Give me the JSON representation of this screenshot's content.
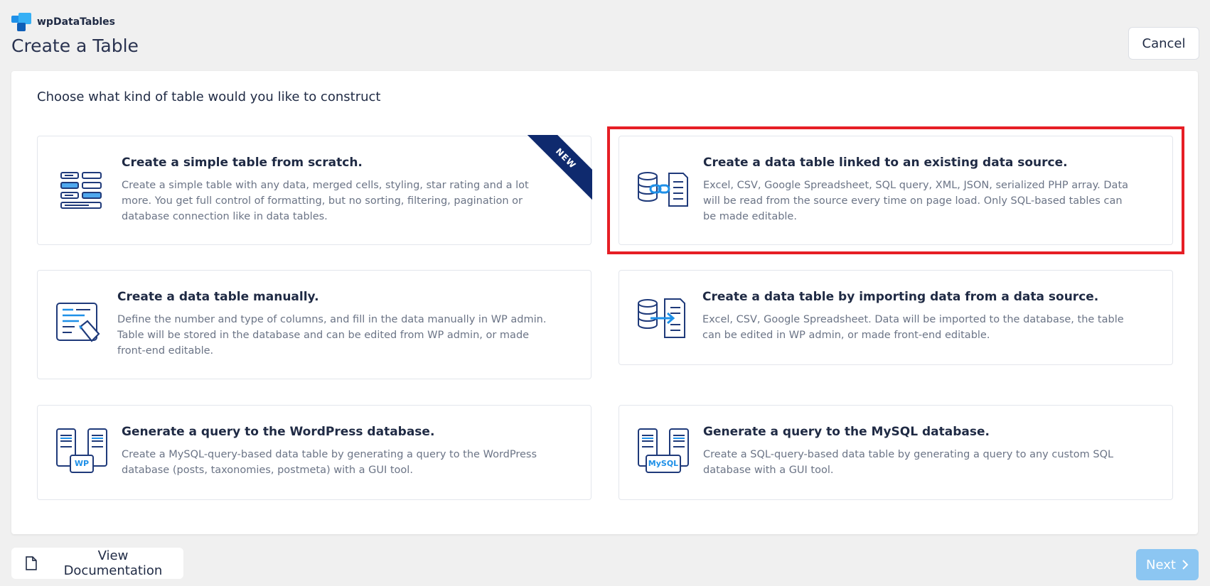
{
  "app": {
    "name": "wpDataTables"
  },
  "page": {
    "title": "Create a Table"
  },
  "header": {
    "cancel_label": "Cancel"
  },
  "main": {
    "heading": "Choose what kind of table would you like to construct",
    "badge_new": "NEW",
    "cards": [
      {
        "title": "Create a simple table from scratch.",
        "description": "Create a simple table with any data, merged cells, styling, star rating and a lot more. You get full control of formatting, but no sorting, filtering, pagination or database connection like in data tables.",
        "icon": "simple-table-icon"
      },
      {
        "title": "Create a data table linked to an existing data source.",
        "description": "Excel, CSV, Google Spreadsheet, SQL query, XML, JSON, serialized PHP array. Data will be read from the source every time on page load. Only SQL-based tables can be made editable.",
        "icon": "linked-data-source-icon"
      },
      {
        "title": "Create a data table manually.",
        "description": "Define the number and type of columns, and fill in the data manually in WP admin. Table will be stored in the database and can be edited from WP admin, or made front-end editable.",
        "icon": "manual-table-icon"
      },
      {
        "title": "Create a data table by importing data from a data source.",
        "description": "Excel, CSV, Google Spreadsheet. Data will be imported to the database, the table can be edited in WP admin, or made front-end editable.",
        "icon": "import-data-icon"
      },
      {
        "title": "Generate a query to the WordPress database.",
        "description": "Create a MySQL-query-based data table by generating a query to the WordPress database (posts, taxonomies, postmeta) with a GUI tool.",
        "icon": "wp-query-icon",
        "icon_label": "WP"
      },
      {
        "title": "Generate a query to the MySQL database.",
        "description": "Create a SQL-query-based data table by generating a query to any custom SQL database with a GUI tool.",
        "icon": "mysql-query-icon",
        "icon_label": "MySQL"
      }
    ]
  },
  "footer": {
    "documentation_label": "View Documentation",
    "next_label": "Next"
  },
  "colors": {
    "accent": "#1e90e8",
    "navy": "#0f2a6e",
    "highlight": "#e61e25",
    "next_disabled": "#8cc6f2"
  }
}
